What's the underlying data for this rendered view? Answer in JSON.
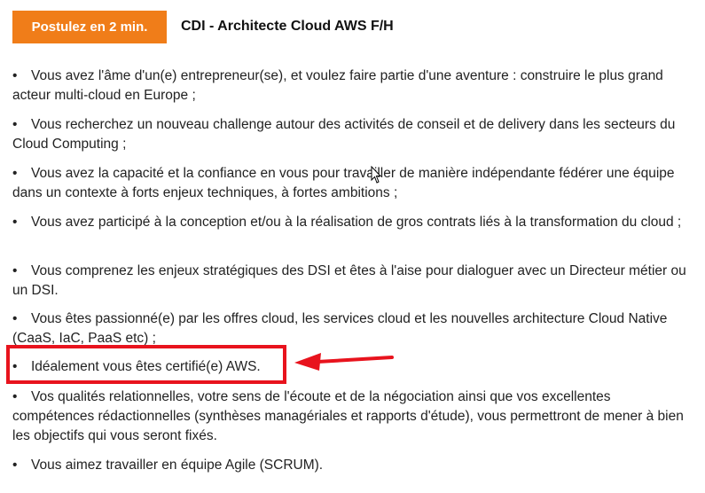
{
  "header": {
    "apply_label": "Postulez en 2 min.",
    "job_title": "CDI - Architecte Cloud AWS F/H"
  },
  "colors": {
    "accent": "#f07d19",
    "highlight": "#e8131d"
  },
  "requirements": [
    "Vous avez l'âme d'un(e) entrepreneur(se), et voulez faire partie d'une aventure : construire le plus grand acteur multi-cloud en Europe ;",
    "Vous recherchez un nouveau challenge autour des activités de conseil et de delivery dans les secteurs du Cloud Computing ;",
    "Vous avez la capacité et la confiance en vous pour travailler de manière indépendante fédérer une équipe dans un contexte à forts enjeux techniques, à fortes ambitions ;",
    "Vous avez participé à la conception et/ou à la réalisation de gros contrats liés à la transformation du cloud ;",
    "Vous comprenez les enjeux stratégiques des DSI et êtes à l'aise pour dialoguer avec un Directeur métier ou un DSI.",
    "Vous êtes passionné(e) par les offres cloud, les services cloud et les nouvelles architecture Cloud Native (CaaS, IaC, PaaS etc) ;",
    "Idéalement vous êtes certifié(e) AWS.",
    "Vos qualités relationnelles, votre sens de l'écoute et de la négociation ainsi que vos excellentes compétences rédactionnelles (synthèses managériales et rapports d'étude), vous permettront de mener à bien les objectifs qui vous seront fixés.",
    "Vous aimez travailler en équipe Agile (SCRUM)."
  ]
}
